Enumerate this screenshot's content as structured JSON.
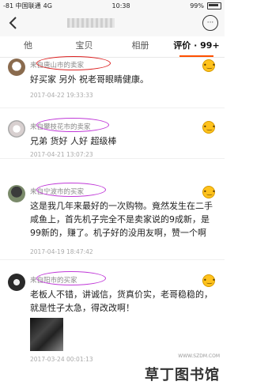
{
  "status_bar": {
    "carrier": "-81 中国联通",
    "network": "4G",
    "time": "10:38",
    "battery": "99%"
  },
  "nav": {
    "back_icon": "chevron-left-icon",
    "more_icon": "more-icon",
    "more_label": "···"
  },
  "tabs": [
    {
      "label": "他"
    },
    {
      "label": "宝贝"
    },
    {
      "label": "相册"
    },
    {
      "label": "评价 · 99+"
    }
  ],
  "reviews": [
    {
      "from_prefix": "来自",
      "from_name": "唐山市的卖家",
      "text": "好买家 另外 祝老哥眼睛健康。",
      "date": "2017-04-22 19:33:33"
    },
    {
      "from_prefix": "来自",
      "from_name": "攀枝花市的卖家",
      "text": "兄弟 货好 人好 超级棒",
      "date": "2017-04-21 13:07:23"
    },
    {
      "from_prefix": "来自",
      "from_name": "宁波市的买家",
      "text": "这是我几年来最好的一次购物。竟然发生在二手咸鱼上，首先机子完全不是卖家说的9成新，是99新的，赚了。机子好的没用友啊，赞一个啊",
      "date": "2017-04-19 18:47:42"
    },
    {
      "from_prefix": "来自",
      "from_name": "阳市的买家",
      "text": "老板人不错，讲诚信，货真价实，老哥稳稳的，就是性子太急，得改改啊！",
      "date": "2017-03-24 00:01:13"
    }
  ],
  "watermark": {
    "small": "WWW.SZDM.COM",
    "large": "草丁图书馆"
  },
  "colors": {
    "accent": "#ff5000",
    "circle_red": "#dd2222",
    "circle_purple": "#c03ad8"
  }
}
